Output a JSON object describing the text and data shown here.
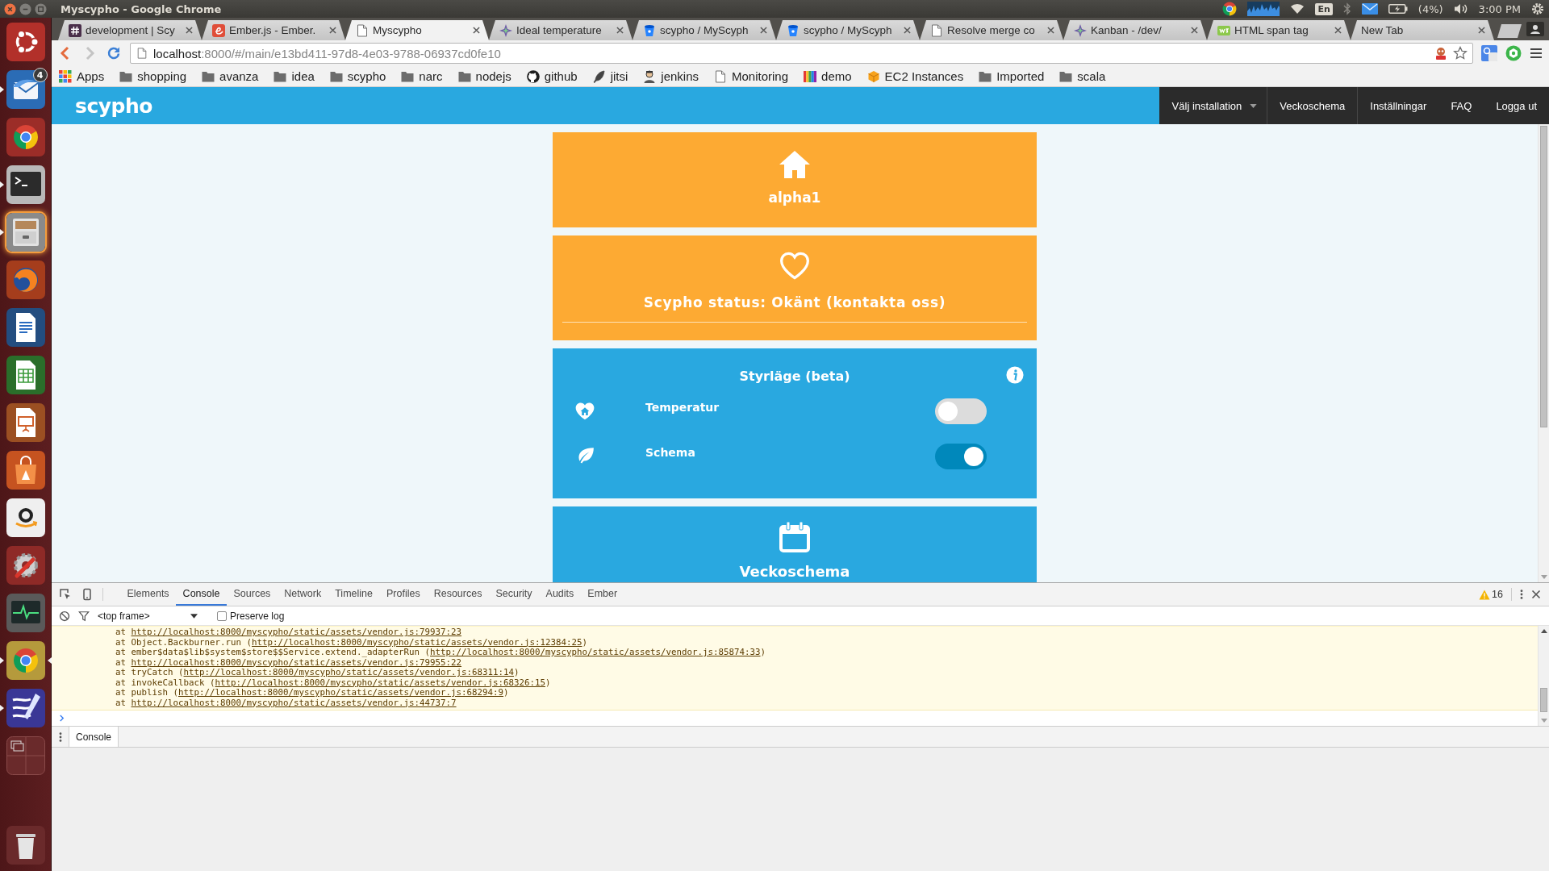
{
  "top_panel": {
    "title": "Myscypho - Google Chrome",
    "keyboard_layout": "En",
    "battery": "(4%)",
    "clock": "3:00 PM"
  },
  "launcher": {
    "items": [
      {
        "kind": "dash",
        "running": false,
        "focused": false,
        "highlighted": false
      },
      {
        "kind": "mail",
        "running": true,
        "focused": false,
        "highlighted": false,
        "badge": "4"
      },
      {
        "kind": "browser",
        "running": false,
        "focused": false,
        "highlighted": false
      },
      {
        "kind": "terminal",
        "running": true,
        "focused": false,
        "highlighted": false
      },
      {
        "kind": "files",
        "running": true,
        "focused": false,
        "highlighted": true
      },
      {
        "kind": "firefox",
        "running": false,
        "focused": false,
        "highlighted": false
      },
      {
        "kind": "writer",
        "running": false,
        "focused": false,
        "highlighted": false
      },
      {
        "kind": "calc",
        "running": false,
        "focused": false,
        "highlighted": false
      },
      {
        "kind": "impress",
        "running": false,
        "focused": false,
        "highlighted": false
      },
      {
        "kind": "software",
        "running": false,
        "focused": false,
        "highlighted": false
      },
      {
        "kind": "store",
        "running": false,
        "focused": false,
        "highlighted": false
      },
      {
        "kind": "settings",
        "running": false,
        "focused": false,
        "highlighted": false
      },
      {
        "kind": "monitor",
        "running": false,
        "focused": false,
        "highlighted": false
      },
      {
        "kind": "browser_alt",
        "running": true,
        "focused": true,
        "highlighted": false
      },
      {
        "kind": "editor",
        "running": true,
        "focused": false,
        "highlighted": false
      },
      {
        "kind": "workspaces",
        "running": false,
        "focused": false,
        "highlighted": false
      }
    ]
  },
  "browser": {
    "tabs": [
      {
        "title": "development | Scy",
        "kind": "hash",
        "selected": false
      },
      {
        "title": "Ember.js - Ember.",
        "kind": "ember",
        "selected": false
      },
      {
        "title": "Myscypho",
        "kind": "page",
        "selected": true
      },
      {
        "title": "Ideal temperature",
        "kind": "spark",
        "selected": false
      },
      {
        "title": "scypho / MyScyph",
        "kind": "bucket",
        "selected": false
      },
      {
        "title": "scypho / MyScyph",
        "kind": "bucket",
        "selected": false
      },
      {
        "title": "Resolve merge co",
        "kind": "page",
        "selected": false
      },
      {
        "title": "Kanban - /dev/",
        "kind": "spark",
        "selected": false
      },
      {
        "title": "HTML span tag",
        "kind": "w3",
        "selected": false
      },
      {
        "title": "New Tab",
        "kind": "none",
        "selected": false
      }
    ],
    "address": {
      "host": "localhost",
      "path": ":8000/#/main/e13bd411-97d8-4e03-9788-06937cd0fe10"
    },
    "bookmarks": [
      {
        "label": "Apps",
        "kind": "apps"
      },
      {
        "label": "shopping",
        "kind": "folder"
      },
      {
        "label": "avanza",
        "kind": "folder"
      },
      {
        "label": "idea",
        "kind": "folder"
      },
      {
        "label": "scypho",
        "kind": "folder"
      },
      {
        "label": "narc",
        "kind": "folder"
      },
      {
        "label": "nodejs",
        "kind": "folder"
      },
      {
        "label": "github",
        "kind": "github"
      },
      {
        "label": "jitsi",
        "kind": "feather"
      },
      {
        "label": "jenkins",
        "kind": "person"
      },
      {
        "label": "Monitoring",
        "kind": "page"
      },
      {
        "label": "demo",
        "kind": "stripes"
      },
      {
        "label": "EC2 Instances",
        "kind": "cube"
      },
      {
        "label": "Imported",
        "kind": "folder"
      },
      {
        "label": "scala",
        "kind": "folder"
      }
    ]
  },
  "app": {
    "logo": "scypho",
    "nav": [
      {
        "label": "Välj installation",
        "kind": "dropdown"
      },
      {
        "label": "Veckoschema",
        "kind": "link"
      },
      {
        "label": "Inställningar",
        "kind": "link"
      },
      {
        "label": "FAQ",
        "kind": "link"
      },
      {
        "label": "Logga ut",
        "kind": "link"
      }
    ],
    "home_card": {
      "title": "alpha1"
    },
    "status_card": {
      "text": "Scypho status: Okänt (kontakta oss)"
    },
    "control_card": {
      "title": "Styrläge (beta)",
      "modes": [
        {
          "label": "Temperatur",
          "kind": "temperature",
          "on": false
        },
        {
          "label": "Schema",
          "kind": "schedule",
          "on": true
        }
      ]
    },
    "schedule_card": {
      "title": "Veckoschema"
    }
  },
  "devtools": {
    "tabs": [
      {
        "label": "Elements",
        "selected": false
      },
      {
        "label": "Console",
        "selected": true
      },
      {
        "label": "Sources",
        "selected": false
      },
      {
        "label": "Network",
        "selected": false
      },
      {
        "label": "Timeline",
        "selected": false
      },
      {
        "label": "Profiles",
        "selected": false
      },
      {
        "label": "Resources",
        "selected": false
      },
      {
        "label": "Security",
        "selected": false
      },
      {
        "label": "Audits",
        "selected": false
      },
      {
        "label": "Ember",
        "selected": false
      }
    ],
    "warnings": "16",
    "context": "<top frame>",
    "preserve_log": {
      "label": "Preserve log",
      "checked": false
    },
    "log": [
      {
        "before": "at ",
        "link": "http://localhost:8000/myscypho/static/assets/vendor.js:79937:23"
      },
      {
        "before": "at Object.Backburner.run (",
        "link": "http://localhost:8000/myscypho/static/assets/vendor.js:12384:25",
        "after": ")"
      },
      {
        "before": "at ember$data$lib$system$store$$Service.extend._adapterRun (",
        "link": "http://localhost:8000/myscypho/static/assets/vendor.js:85874:33",
        "after": ")"
      },
      {
        "before": "at ",
        "link": "http://localhost:8000/myscypho/static/assets/vendor.js:79955:22"
      },
      {
        "before": "at tryCatch (",
        "link": "http://localhost:8000/myscypho/static/assets/vendor.js:68311:14",
        "after": ")"
      },
      {
        "before": "at invokeCallback (",
        "link": "http://localhost:8000/myscypho/static/assets/vendor.js:68326:15",
        "after": ")"
      },
      {
        "before": "at publish (",
        "link": "http://localhost:8000/myscypho/static/assets/vendor.js:68294:9",
        "after": ")"
      },
      {
        "before": "at ",
        "link": "http://localhost:8000/myscypho/static/assets/vendor.js:44737:7"
      }
    ],
    "drawer_tabs": [
      {
        "label": "Console",
        "selected": true
      }
    ]
  }
}
